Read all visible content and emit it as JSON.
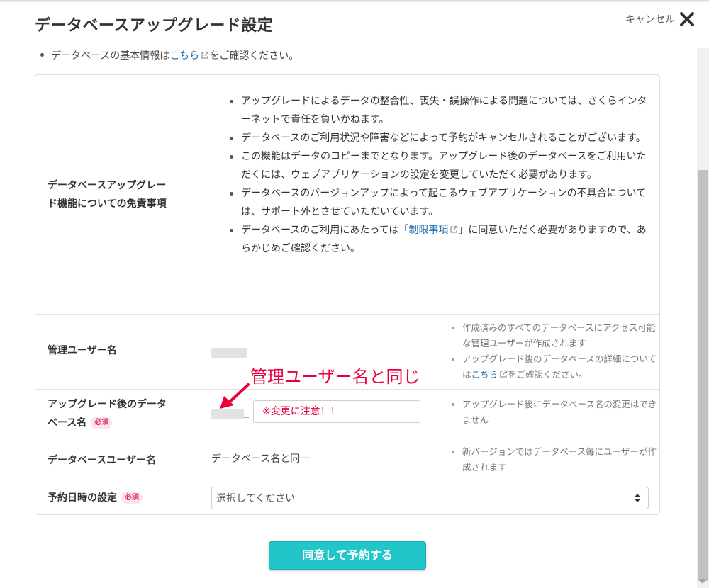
{
  "header": {
    "title": "データベースアップグレード設定",
    "cancel_label": "キャンセル"
  },
  "info": {
    "prefix": "データベースの基本情報は",
    "link": "こちら",
    "suffix": "をご確認ください。"
  },
  "disclaimer": {
    "label_line1": "データベースアップグレー",
    "label_line2": "ド機能についての免責事項",
    "items": [
      "アップグレードによるデータの整合性、喪失・誤操作による問題については、さくらインターネットで責任を負いかねます。",
      "データベースのご利用状況や障害などによって予約がキャンセルされることがございます。",
      "この機能はデータのコピーまでとなります。アップグレード後のデータベースをご利用いただくには、ウェブアプリケーションの設定を変更していただく必要があります。",
      "データベースのバージョンアップによって起こるウェブアプリケーションの不具合については、サポート外とさせていただいています。"
    ],
    "last_item_prefix": "データベースのご利用にあたっては「",
    "last_item_link": "制限事項",
    "last_item_suffix": "」に同意いただく必要がありますので、あらかじめご確認ください。"
  },
  "admin_user": {
    "label": "管理ユーザー名",
    "note1": "作成済みのすべてのデータベースにアクセス可能な管理ユーザーが作成されます",
    "note2_prefix": "アップグレード後のデータベースの詳細については",
    "note2_link": "こちら",
    "note2_suffix": "をご確認ください。"
  },
  "annotation": {
    "text": "管理ユーザー名と同じ"
  },
  "db_name": {
    "label_line1": "アップグレード後のデータ",
    "label_line2": "ベース名",
    "required_badge": "必須",
    "separator": "_",
    "input_value": "※変更に注意！！",
    "note": "アップグレード後にデータベース名の変更はできません"
  },
  "db_user": {
    "label": "データベースユーザー名",
    "value": "データベース名と同一",
    "note": "新バージョンではデータベース毎にユーザーが作成されます"
  },
  "schedule": {
    "label": "予約日時の設定",
    "required_badge": "必須",
    "select_value": "選択してください"
  },
  "submit": {
    "label": "同意して予約する"
  },
  "colors": {
    "accent": "#23c6c8",
    "link": "#1f6fb2",
    "annotation": "#e8003b",
    "required_bg": "#fde3ea"
  }
}
